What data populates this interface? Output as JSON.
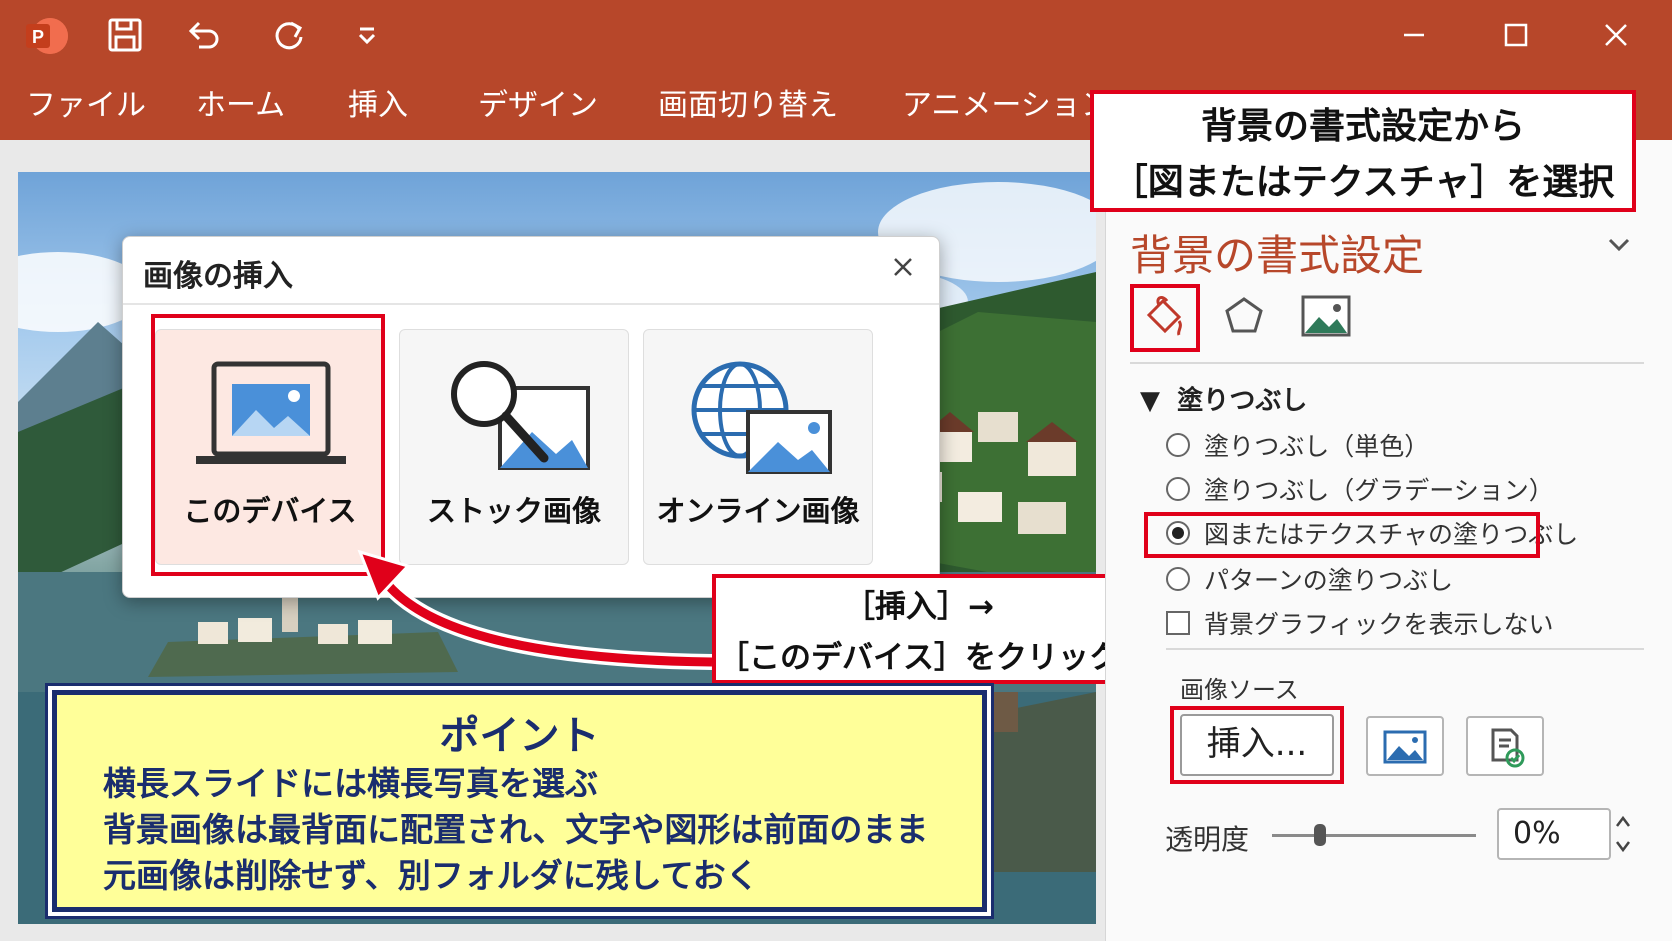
{
  "ribbon": {
    "tabs": [
      "ファイル",
      "ホーム",
      "挿入",
      "デザイン",
      "画面切り替え",
      "アニメーション"
    ]
  },
  "colors": {
    "accent": "#b7472a",
    "highlight": "#e0001a",
    "point_bg": "#ffff99",
    "point_border": "#1a2d6e"
  },
  "dialog": {
    "title": "画像の挿入",
    "options": [
      "このデバイス",
      "ストック画像",
      "オンライン画像"
    ]
  },
  "callouts": {
    "top_right": {
      "line1": "背景の書式設定から",
      "line2": "［図またはテクスチャ］を選択"
    },
    "middle": {
      "line1": "［挿入］→",
      "line2": "［このデバイス］をクリック"
    }
  },
  "point": {
    "title": "ポイント",
    "lines": [
      "横長スライドには横長写真を選ぶ",
      "背景画像は最背面に配置され、文字や図形は前面のまま",
      "元画像は削除せず、別フォルダに残しておく"
    ]
  },
  "pane": {
    "title": "背景の書式設定",
    "fill_header": "塗りつぶし",
    "options": [
      {
        "label": "塗りつぶし（単色）",
        "checked": false
      },
      {
        "label": "塗りつぶし（グラデーション）",
        "checked": false
      },
      {
        "label": "図またはテクスチャの塗りつぶし",
        "checked": true
      },
      {
        "label": "パターンの塗りつぶし",
        "checked": false
      }
    ],
    "hide_graphics": "背景グラフィックを表示しない",
    "image_source_label": "画像ソース",
    "insert_button": "挿入...",
    "transparency_label": "透明度",
    "transparency_value": "0%"
  }
}
